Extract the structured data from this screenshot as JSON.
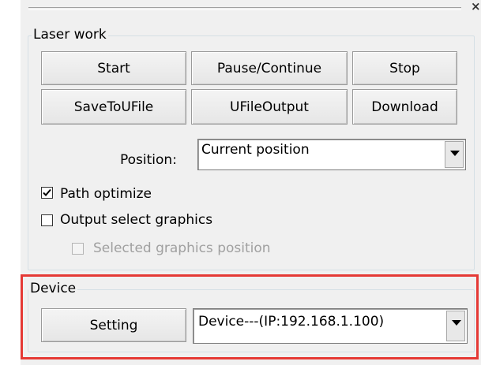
{
  "laser_work": {
    "title": "Laser work",
    "buttons": {
      "start": "Start",
      "pause_continue": "Pause/Continue",
      "stop": "Stop",
      "save_to_ufile": "SaveToUFile",
      "ufile_output": "UFileOutput",
      "download": "Download"
    },
    "position_label": "Position:",
    "position_value": "Current position",
    "path_optimize": {
      "label": "Path optimize",
      "checked": true
    },
    "output_select_graphics": {
      "label": "Output select graphics",
      "checked": false
    },
    "selected_graphics_position": {
      "label": "Selected graphics position",
      "checked": false,
      "enabled": false
    }
  },
  "device": {
    "title": "Device",
    "setting_button": "Setting",
    "device_value": "Device---(IP:192.168.1.100)"
  },
  "colors": {
    "panel_bg": "#f0f0f0",
    "highlight_border": "#e53935"
  },
  "icons": {
    "close": "close-icon",
    "dropdown": "chevron-down-icon",
    "check": "check-icon"
  }
}
